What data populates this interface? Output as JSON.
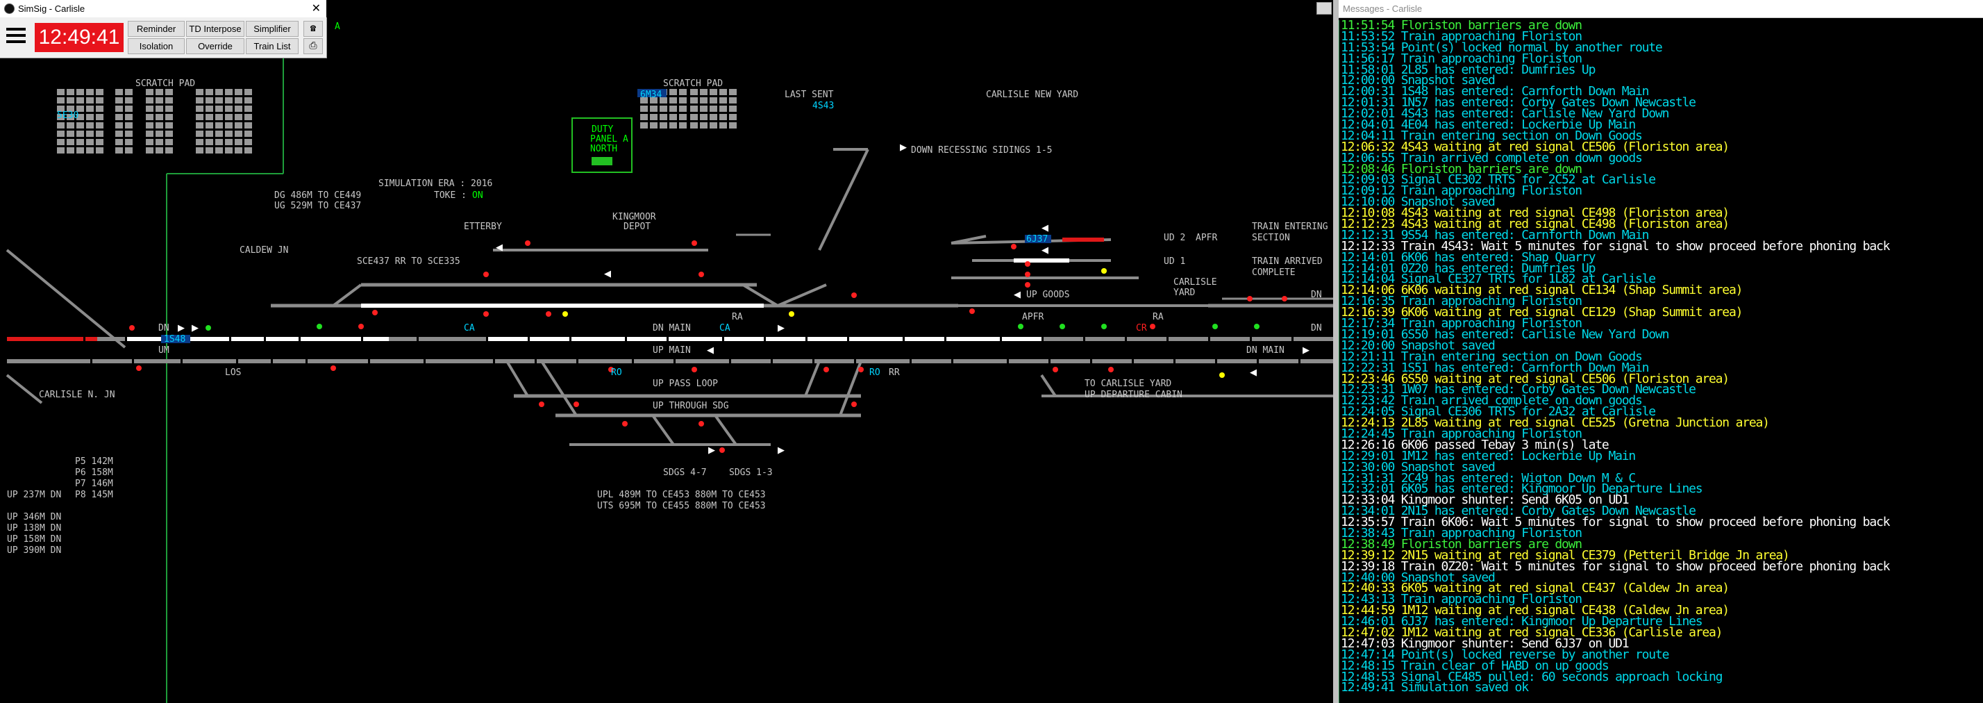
{
  "colors": {
    "track": "#8c8c8c",
    "set_route": "#ffffff",
    "occupied": "#e01818",
    "label_grey": "#c8c8c8",
    "label_cyan": "#00d4ff",
    "label_green": "#00ff00",
    "label_yellow": "#ffff00",
    "signal_red": "#ff2020",
    "signal_green": "#20e020",
    "clock_bg": "#e8141c"
  },
  "main_window": {
    "title": "SimSig - Carlisle",
    "clock": "12:49:41",
    "buttons": [
      "Reminder",
      "TD Interpose",
      "Simplifier",
      "Isolation",
      "Override",
      "Train List"
    ],
    "icons": [
      "phone-icon",
      "printer-icon"
    ],
    "menu_icon": "hamburger-icon"
  },
  "diagram": {
    "labels": [
      {
        "text": "SCRATCH PAD",
        "color": "grey",
        "name": "scratch-pad-left"
      },
      {
        "text": "SCRATCH PAD",
        "color": "grey",
        "name": "scratch-pad-right"
      },
      {
        "text": "5E30",
        "color": "cyan",
        "name": "berth-5e30"
      },
      {
        "text": "6M34",
        "color": "cyan",
        "name": "berth-6m34"
      },
      {
        "text": "LAST SENT",
        "color": "grey",
        "name": "last-sent-label"
      },
      {
        "text": "4S43",
        "color": "cyan",
        "name": "last-sent-value"
      },
      {
        "text": "CARLISLE NEW YARD",
        "color": "grey",
        "name": "carlisle-new-yard-label"
      },
      {
        "text": "DUTY",
        "color": "green",
        "name": "duty-panel-line1"
      },
      {
        "text": "PANEL A",
        "color": "green",
        "name": "duty-panel-line2"
      },
      {
        "text": "NORTH",
        "color": "green",
        "name": "duty-panel-line3"
      },
      {
        "text": "DOWN RECESSING SIDINGS 1-5",
        "color": "grey",
        "name": "down-recessing-sidings-label"
      },
      {
        "text": "SIMULATION ERA : 2016",
        "color": "grey",
        "name": "simulation-era"
      },
      {
        "text": "TOKE :",
        "color": "grey",
        "name": "toke-label"
      },
      {
        "text": "ON",
        "color": "green",
        "name": "toke-value"
      },
      {
        "text": "DG 486M TO CE449",
        "color": "grey",
        "name": "dg-length"
      },
      {
        "text": "UG 529M TO CE437",
        "color": "grey",
        "name": "ug-length"
      },
      {
        "text": "KINGMOOR",
        "color": "grey",
        "name": "kingmoor-label"
      },
      {
        "text": "DEPOT",
        "color": "grey",
        "name": "depot-label"
      },
      {
        "text": "ETTERBY",
        "color": "grey",
        "name": "etterby-label"
      },
      {
        "text": "CALDEW JN",
        "color": "grey",
        "name": "caldew-jn-label"
      },
      {
        "text": "SCE437 RR TO SCE335",
        "color": "grey",
        "name": "sce437-label"
      },
      {
        "text": "TRAIN ENTERING",
        "color": "grey",
        "name": "train-entering-line1"
      },
      {
        "text": "SECTION",
        "color": "grey",
        "name": "train-entering-line2"
      },
      {
        "text": "TRAIN ARRIVED",
        "color": "grey",
        "name": "train-arrived-line1"
      },
      {
        "text": "COMPLETE",
        "color": "grey",
        "name": "train-arrived-line2"
      },
      {
        "text": "APFR",
        "color": "grey",
        "name": "apfr-label-top"
      },
      {
        "text": "UD 2",
        "color": "grey",
        "name": "ud2-label"
      },
      {
        "text": "UD 1",
        "color": "grey",
        "name": "ud1-label"
      },
      {
        "text": "CARLISLE",
        "color": "grey",
        "name": "carlisle-yard-line1"
      },
      {
        "text": "YARD",
        "color": "grey",
        "name": "carlisle-yard-line2"
      },
      {
        "text": "6J37",
        "color": "cyan",
        "name": "berth-6j37"
      },
      {
        "text": "UP GOODS",
        "color": "grey",
        "name": "up-goods-label"
      },
      {
        "text": "APFR",
        "color": "grey",
        "name": "apfr-label-mid"
      },
      {
        "text": "DN",
        "color": "grey",
        "name": "dn-edge-label"
      },
      {
        "text": "DN",
        "color": "grey",
        "name": "dn-edge-label2"
      },
      {
        "text": "DN",
        "color": "grey",
        "name": "dn-left-label"
      },
      {
        "text": "1S48",
        "color": "cyan",
        "name": "berth-1s48"
      },
      {
        "text": "UM",
        "color": "grey",
        "name": "um-label"
      },
      {
        "text": "LOS",
        "color": "grey",
        "name": "los-label"
      },
      {
        "text": "CARLISLE N. JN",
        "color": "grey",
        "name": "carlisle-n-jn-label"
      },
      {
        "text": "DN MAIN",
        "color": "grey",
        "name": "dn-main-label"
      },
      {
        "text": "CA",
        "color": "cyan",
        "name": "ca-label-1"
      },
      {
        "text": "CA",
        "color": "cyan",
        "name": "ca-label-2"
      },
      {
        "text": "RA",
        "color": "grey",
        "name": "ra-label-1"
      },
      {
        "text": "UP MAIN",
        "color": "grey",
        "name": "up-main-label"
      },
      {
        "text": "RO",
        "color": "cyan",
        "name": "ro-label-1"
      },
      {
        "text": "RO",
        "color": "cyan",
        "name": "ro-label-2"
      },
      {
        "text": "RR",
        "color": "grey",
        "name": "rr-label"
      },
      {
        "text": "RA",
        "color": "grey",
        "name": "ra-label-2"
      },
      {
        "text": "CR",
        "color": "red",
        "name": "cr-label"
      },
      {
        "text": "DN MAIN",
        "color": "grey",
        "name": "dn-main-right-label"
      },
      {
        "text": "UP PASS LOOP",
        "color": "grey",
        "name": "up-pass-loop-label"
      },
      {
        "text": "UP THROUGH SDG",
        "color": "grey",
        "name": "up-through-sdg-label"
      },
      {
        "text": "TO CARLISLE YARD",
        "color": "grey",
        "name": "to-carlisle-yard-label"
      },
      {
        "text": "UP DEPARTURE CABIN",
        "color": "grey",
        "name": "up-departure-cabin-label"
      },
      {
        "text": "SDGS 4-7",
        "color": "grey",
        "name": "sdgs-4-7-label"
      },
      {
        "text": "SDGS 1-3",
        "color": "grey",
        "name": "sdgs-1-3-label"
      },
      {
        "text": "UPL 489M TO CE453 880M TO CE453",
        "color": "grey",
        "name": "upl-length"
      },
      {
        "text": "UTS 695M TO CE455 880M TO CE453",
        "color": "grey",
        "name": "uts-length"
      },
      {
        "text": "P5 142M",
        "color": "grey",
        "name": "p5-length"
      },
      {
        "text": "P6 158M",
        "color": "grey",
        "name": "p6-length"
      },
      {
        "text": "P7 146M",
        "color": "grey",
        "name": "p7-length"
      },
      {
        "text": "P8 145M",
        "color": "grey",
        "name": "p8-length"
      },
      {
        "text": "UP 237M DN",
        "color": "grey",
        "name": "up-237m"
      },
      {
        "text": "UP 346M DN",
        "color": "grey",
        "name": "up-346m"
      },
      {
        "text": "UP 138M DN",
        "color": "grey",
        "name": "up-138m"
      },
      {
        "text": "UP 158M DN",
        "color": "grey",
        "name": "up-158m"
      },
      {
        "text": "UP 390M DN",
        "color": "grey",
        "name": "up-390m"
      },
      {
        "text": "A",
        "color": "green",
        "name": "a-marker"
      }
    ]
  },
  "messages_window": {
    "title": "Messages - Carlisle",
    "messages": [
      {
        "text": "11:51:54 Floriston barriers are down",
        "color": "green"
      },
      {
        "text": "11:53:52 Train approaching Floriston",
        "color": "cyan"
      },
      {
        "text": "11:53:54 Point(s) locked normal by another route",
        "color": "cyan"
      },
      {
        "text": "11:56:17 Train approaching Floriston",
        "color": "cyan"
      },
      {
        "text": "11:58:01 2L85 has entered: Dumfries Up",
        "color": "cyan"
      },
      {
        "text": "12:00:00 Snapshot saved",
        "color": "cyan"
      },
      {
        "text": "12:00:31 1S48 has entered: Carnforth Down Main",
        "color": "cyan"
      },
      {
        "text": "12:01:31 1N57 has entered: Corby Gates Down Newcastle",
        "color": "cyan"
      },
      {
        "text": "12:02:01 4S43 has entered: Carlisle New Yard Down",
        "color": "cyan"
      },
      {
        "text": "12:04:01 4E04 has entered: Lockerbie Up Main",
        "color": "cyan"
      },
      {
        "text": "12:04:11 Train entering section on Down Goods",
        "color": "cyan"
      },
      {
        "text": "12:06:32 4S43 waiting at red signal CE506 (Floriston area)",
        "color": "yellow"
      },
      {
        "text": "12:06:55 Train arrived complete on down goods",
        "color": "cyan"
      },
      {
        "text": "12:08:46 Floriston barriers are down",
        "color": "green"
      },
      {
        "text": "12:09:03 Signal CE302 TRTS for 2C52 at Carlisle",
        "color": "cyan"
      },
      {
        "text": "12:09:12 Train approaching Floriston",
        "color": "cyan"
      },
      {
        "text": "12:10:00 Snapshot saved",
        "color": "cyan"
      },
      {
        "text": "12:10:08 4S43 waiting at red signal CE498 (Floriston area)",
        "color": "yellow"
      },
      {
        "text": "12:12:23 4S43 waiting at red signal CE498 (Floriston area)",
        "color": "yellow"
      },
      {
        "text": "12:12:31 9S54 has entered: Carnforth Down Main",
        "color": "cyan"
      },
      {
        "text": "12:12:33 Train 4S43: Wait 5 minutes for signal to show proceed before phoning back",
        "color": "white"
      },
      {
        "text": "12:14:01 6K06 has entered: Shap Quarry",
        "color": "cyan"
      },
      {
        "text": "12:14:01 0Z20 has entered: Dumfries Up",
        "color": "cyan"
      },
      {
        "text": "12:14:04 Signal CE327 TRTS for 1L82 at Carlisle",
        "color": "cyan"
      },
      {
        "text": "12:14:06 6K06 waiting at red signal CE134 (Shap Summit area)",
        "color": "yellow"
      },
      {
        "text": "12:16:35 Train approaching Floriston",
        "color": "cyan"
      },
      {
        "text": "12:16:39 6K06 waiting at red signal CE129 (Shap Summit area)",
        "color": "yellow"
      },
      {
        "text": "12:17:34 Train approaching Floriston",
        "color": "cyan"
      },
      {
        "text": "12:19:01 6S50 has entered: Carlisle New Yard Down",
        "color": "cyan"
      },
      {
        "text": "12:20:00 Snapshot saved",
        "color": "cyan"
      },
      {
        "text": "12:21:11 Train entering section on Down Goods",
        "color": "cyan"
      },
      {
        "text": "12:22:31 1S51 has entered: Carnforth Down Main",
        "color": "cyan"
      },
      {
        "text": "12:23:46 6S50 waiting at red signal CE506 (Floriston area)",
        "color": "yellow"
      },
      {
        "text": "12:23:31 1W07 has entered: Corby Gates Down Newcastle",
        "color": "cyan"
      },
      {
        "text": "12:23:42 Train arrived complete on down goods",
        "color": "cyan"
      },
      {
        "text": "12:24:05 Signal CE306 TRTS for 2A32 at Carlisle",
        "color": "cyan"
      },
      {
        "text": "12:24:13 2L85 waiting at red signal CE525 (Gretna Junction area)",
        "color": "yellow"
      },
      {
        "text": "12:24:45 Train approaching Floriston",
        "color": "cyan"
      },
      {
        "text": "12:26:16 6K06 passed Tebay 3 min(s) late",
        "color": "white"
      },
      {
        "text": "12:29:01 1M12 has entered: Lockerbie Up Main",
        "color": "cyan"
      },
      {
        "text": "12:30:00 Snapshot saved",
        "color": "cyan"
      },
      {
        "text": "12:31:31 2C49 has entered: Wigton Down M & C",
        "color": "cyan"
      },
      {
        "text": "12:32:01 6K05 has entered: Kingmoor Up Departure Lines",
        "color": "cyan"
      },
      {
        "text": "12:33:04 Kingmoor shunter: Send 6K05 on UD1",
        "color": "white"
      },
      {
        "text": "12:34:01 2N15 has entered: Corby Gates Down Newcastle",
        "color": "cyan"
      },
      {
        "text": "12:35:57 Train 6K06: Wait 5 minutes for signal to show proceed before phoning back",
        "color": "white"
      },
      {
        "text": "12:38:43 Train approaching Floriston",
        "color": "cyan"
      },
      {
        "text": "12:38:49 Floriston barriers are down",
        "color": "green"
      },
      {
        "text": "12:39:12 2N15 waiting at red signal CE379 (Petteril Bridge Jn area)",
        "color": "yellow"
      },
      {
        "text": "12:39:18 Train 0Z20: Wait 5 minutes for signal to show proceed before phoning back",
        "color": "white"
      },
      {
        "text": "12:40:00 Snapshot saved",
        "color": "cyan"
      },
      {
        "text": "12:40:33 6K05 waiting at red signal CE437 (Caldew Jn area)",
        "color": "yellow"
      },
      {
        "text": "12:43:13 Train approaching Floriston",
        "color": "cyan"
      },
      {
        "text": "12:44:59 1M12 waiting at red signal CE438 (Caldew Jn area)",
        "color": "yellow"
      },
      {
        "text": "12:46:01 6J37 has entered: Kingmoor Up Departure Lines",
        "color": "cyan"
      },
      {
        "text": "12:47:02 1M12 waiting at red signal CE336 (Carlisle area)",
        "color": "yellow"
      },
      {
        "text": "12:47:03 Kingmoor shunter: Send 6J37 on UD1",
        "color": "white"
      },
      {
        "text": "12:47:14 Point(s) locked reverse by another route",
        "color": "cyan"
      },
      {
        "text": "12:48:15 Train clear of HABD on up goods",
        "color": "cyan"
      },
      {
        "text": "12:48:53 Signal CE485 pulled: 60 seconds approach locking",
        "color": "cyan"
      },
      {
        "text": "12:49:41 Simulation saved ok",
        "color": "cyan"
      }
    ]
  }
}
